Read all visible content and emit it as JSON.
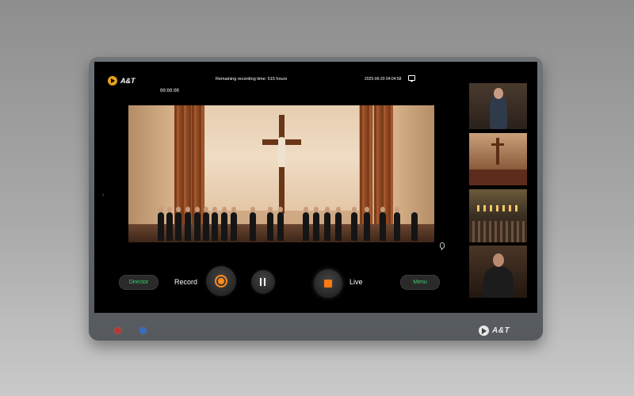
{
  "app": {
    "brand": "A&T",
    "timer": "00:00:00",
    "remaining_recording": "Remaining recording time: 515 hours",
    "datetime": "2025-06-20 04:04:58"
  },
  "controls": {
    "director_label": "Director",
    "record_label": "Record",
    "live_label": "Live",
    "menu_label": "Menu"
  },
  "device": {
    "bezel_brand": "A&T"
  },
  "icons": {
    "record": "record-icon",
    "pause": "pause-icon",
    "live_stop": "stop-icon",
    "microphone": "microphone-icon",
    "screen": "screen-icon",
    "chevron": "chevron-left-icon",
    "logo": "logo-icon"
  },
  "colors": {
    "accent_orange": "#ff8a1e",
    "button_text_green": "#36d36a",
    "screen_bg": "#000000",
    "led_red": "#c6322a",
    "led_blue": "#2f6fd0"
  }
}
